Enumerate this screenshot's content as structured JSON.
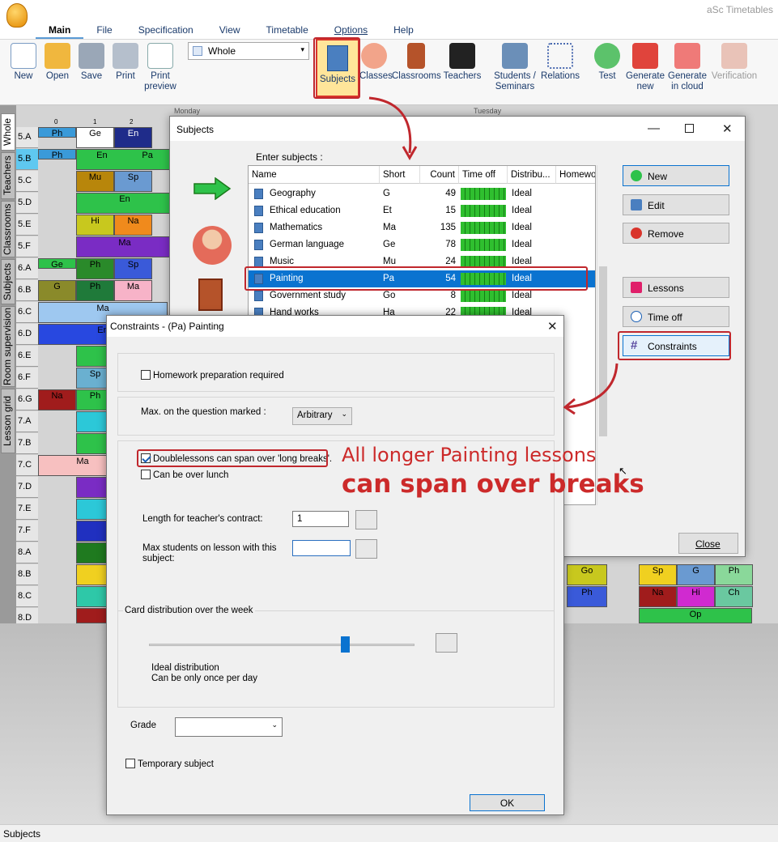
{
  "app": {
    "title": "aSc Timetables"
  },
  "ribbon_tabs": [
    "Main",
    "File",
    "Specification",
    "View",
    "Timetable",
    "Options",
    "Help"
  ],
  "ribbon_buttons": [
    {
      "label": "New",
      "icon": "new-document-icon"
    },
    {
      "label": "Open",
      "icon": "folder-open-icon"
    },
    {
      "label": "Save",
      "icon": "save-disk-icon"
    },
    {
      "label": "Print",
      "icon": "printer-icon"
    },
    {
      "label": "Print preview",
      "icon": "print-preview-icon"
    },
    {
      "label": "Subjects",
      "icon": "subjects-book-icon"
    },
    {
      "label": "Classes",
      "icon": "classes-people-icon"
    },
    {
      "label": "Classrooms",
      "icon": "classroom-door-icon"
    },
    {
      "label": "Teachers",
      "icon": "graduation-cap-icon"
    },
    {
      "label": "Students / Seminars",
      "icon": "students-icon"
    },
    {
      "label": "Relations",
      "icon": "relations-network-icon"
    },
    {
      "label": "Test",
      "icon": "test-check-icon"
    },
    {
      "label": "Generate new",
      "icon": "generate-siren-icon"
    },
    {
      "label": "Generate in cloud",
      "icon": "generate-cloud-icon"
    },
    {
      "label": "Verification",
      "icon": "verification-gavel-icon"
    }
  ],
  "view_select": "Whole",
  "side_tabs": [
    "Whole",
    "Teachers",
    "Classrooms",
    "Subjects",
    "Room supervision",
    "Lesson grid"
  ],
  "grid": {
    "day_headers": [
      "Monday",
      "Tuesday"
    ],
    "period_headers": [
      "0",
      "1",
      "2"
    ],
    "rows": [
      "5.A",
      "5.B",
      "5.C",
      "5.D",
      "5.E",
      "5.F",
      "6.A",
      "6.B",
      "6.C",
      "6.D",
      "6.E",
      "6.F",
      "6.G",
      "7.A",
      "7.B",
      "7.C",
      "7.D",
      "7.E",
      "7.F",
      "8.A",
      "8.B",
      "8.C",
      "8.D"
    ]
  },
  "subjects_dialog": {
    "title": "Subjects",
    "enter_label": "Enter subjects :",
    "columns": [
      "Name",
      "Short",
      "Count",
      "Time off",
      "Distribu...",
      "Homewo..."
    ],
    "rows": [
      {
        "name": "Geography",
        "short": "G",
        "count": "49",
        "dist": "Ideal"
      },
      {
        "name": "Ethical education",
        "short": "Et",
        "count": "15",
        "dist": "Ideal"
      },
      {
        "name": "Mathematics",
        "short": "Ma",
        "count": "135",
        "dist": "Ideal"
      },
      {
        "name": "German language",
        "short": "Ge",
        "count": "78",
        "dist": "Ideal"
      },
      {
        "name": "Music",
        "short": "Mu",
        "count": "24",
        "dist": "Ideal"
      },
      {
        "name": "Painting",
        "short": "Pa",
        "count": "54",
        "dist": "Ideal"
      },
      {
        "name": "Government study",
        "short": "Go",
        "count": "8",
        "dist": "Ideal"
      },
      {
        "name": "Hand works",
        "short": "Ha",
        "count": "22",
        "dist": "Ideal"
      }
    ],
    "buttons": {
      "new": "New",
      "edit": "Edit",
      "remove": "Remove",
      "lessons": "Lessons",
      "time_off": "Time off",
      "constraints": "Constraints",
      "close": "Close"
    }
  },
  "constraints_dialog": {
    "title": "Constraints - (Pa) Painting",
    "homework": "Homework preparation required",
    "max_question_label": "Max. on the question marked :",
    "max_question_value": "Arbitrary",
    "doublelessons": "Doublelessons can span over 'long breaks'.",
    "over_lunch": "Can be over lunch",
    "contract_label": "Length for teacher's contract:",
    "contract_value": "1",
    "max_students_label": "Max students on lesson with this subject:",
    "distribution_group": "Card distribution over the week",
    "distribution_line1": "Ideal distribution",
    "distribution_line2": "Can be only once per day",
    "grade_label": "Grade",
    "temporary": "Temporary subject",
    "ok": "OK"
  },
  "annotation": {
    "line1": "All longer Painting lessons",
    "line2": "can span over breaks"
  },
  "status_bar": "Subjects",
  "colors": {
    "accent_red": "#c0272d",
    "selection_blue": "#0a73d0",
    "subjects_highlight": "#ffe59a"
  }
}
